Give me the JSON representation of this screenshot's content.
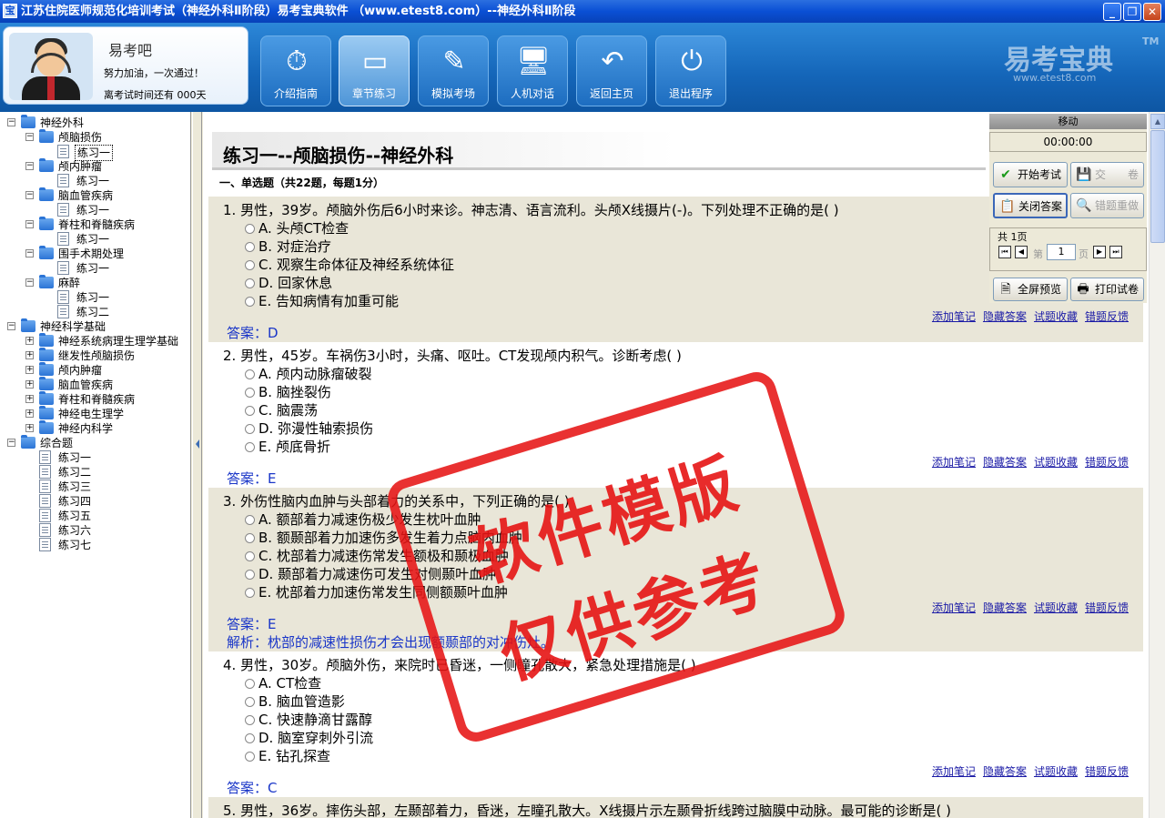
{
  "window": {
    "title": "江苏住院医师规范化培训考试（神经外科Ⅱ阶段）易考宝典软件  （www.etest8.com）--神经外科Ⅱ阶段",
    "app_icon": "宝"
  },
  "profile": {
    "name": "易考吧",
    "motto": "努力加油，一次通过！",
    "countdown": "离考试时间还有 000天"
  },
  "nav": [
    {
      "label": "介绍指南",
      "icon": "stopwatch-icon",
      "glyph": "⏱"
    },
    {
      "label": "章节练习",
      "icon": "windows-icon",
      "glyph": "▭"
    },
    {
      "label": "模拟考场",
      "icon": "exam-icon",
      "glyph": "✎"
    },
    {
      "label": "人机对话",
      "icon": "computer-user-icon",
      "glyph": "🖥"
    },
    {
      "label": "返回主页",
      "icon": "return-arrow-icon",
      "glyph": "↶"
    },
    {
      "label": "退出程序",
      "icon": "power-icon",
      "glyph": "⏻"
    }
  ],
  "logo": {
    "text": "易考宝典",
    "tm": "TM",
    "url": "www.etest8.com"
  },
  "tree": [
    {
      "label": "神经外科",
      "type": "folder",
      "level": 0,
      "toggle": "−"
    },
    {
      "label": "颅脑损伤",
      "type": "folder",
      "level": 1,
      "toggle": "−"
    },
    {
      "label": "练习一",
      "type": "page",
      "level": 2,
      "selected": true
    },
    {
      "label": "颅内肿瘤",
      "type": "folder",
      "level": 1,
      "toggle": "−"
    },
    {
      "label": "练习一",
      "type": "page",
      "level": 2
    },
    {
      "label": "脑血管疾病",
      "type": "folder",
      "level": 1,
      "toggle": "−"
    },
    {
      "label": "练习一",
      "type": "page",
      "level": 2
    },
    {
      "label": "脊柱和脊髓疾病",
      "type": "folder",
      "level": 1,
      "toggle": "−"
    },
    {
      "label": "练习一",
      "type": "page",
      "level": 2
    },
    {
      "label": "围手术期处理",
      "type": "folder",
      "level": 1,
      "toggle": "−"
    },
    {
      "label": "练习一",
      "type": "page",
      "level": 2
    },
    {
      "label": "麻醉",
      "type": "folder",
      "level": 1,
      "toggle": "−"
    },
    {
      "label": "练习一",
      "type": "page",
      "level": 2
    },
    {
      "label": "练习二",
      "type": "page",
      "level": 2
    },
    {
      "label": "神经科学基础",
      "type": "folder",
      "level": 0,
      "toggle": "−"
    },
    {
      "label": "神经系统病理生理学基础",
      "type": "folder",
      "level": 1,
      "toggle": "+"
    },
    {
      "label": "继发性颅脑损伤",
      "type": "folder",
      "level": 1,
      "toggle": "+"
    },
    {
      "label": "颅内肿瘤",
      "type": "folder",
      "level": 1,
      "toggle": "+"
    },
    {
      "label": "脑血管疾病",
      "type": "folder",
      "level": 1,
      "toggle": "+"
    },
    {
      "label": "脊柱和脊髓疾病",
      "type": "folder",
      "level": 1,
      "toggle": "+"
    },
    {
      "label": "神经电生理学",
      "type": "folder",
      "level": 1,
      "toggle": "+"
    },
    {
      "label": "神经内科学",
      "type": "folder",
      "level": 1,
      "toggle": "+"
    },
    {
      "label": "综合题",
      "type": "folder",
      "level": 0,
      "toggle": "−"
    },
    {
      "label": "练习一",
      "type": "page",
      "level": 1
    },
    {
      "label": "练习二",
      "type": "page",
      "level": 1
    },
    {
      "label": "练习三",
      "type": "page",
      "level": 1
    },
    {
      "label": "练习四",
      "type": "page",
      "level": 1
    },
    {
      "label": "练习五",
      "type": "page",
      "level": 1
    },
    {
      "label": "练习六",
      "type": "page",
      "level": 1
    },
    {
      "label": "练习七",
      "type": "page",
      "level": 1
    }
  ],
  "content": {
    "title": "练习一--颅脑损伤--神经外科",
    "section": "一、单选题（共22题，每题1分）",
    "links": [
      "添加笔记",
      "隐藏答案",
      "试题收藏",
      "错题反馈"
    ],
    "questions": [
      {
        "text": "1. 男性，39岁。颅脑外伤后6小时来诊。神志清、语言流利。头颅X线摄片(-)。下列处理不正确的是(   )",
        "options": [
          "A. 头颅CT检查",
          "B. 对症治疗",
          "C. 观察生命体征及神经系统体征",
          "D. 回家休息",
          "E. 告知病情有加重可能"
        ],
        "answer": "答案：D",
        "analysis": ""
      },
      {
        "text": "2. 男性，45岁。车祸伤3小时，头痛、呕吐。CT发现颅内积气。诊断考虑(   )",
        "options": [
          "A. 颅内动脉瘤破裂",
          "B. 脑挫裂伤",
          "C. 脑震荡",
          "D. 弥漫性轴索损伤",
          "E. 颅底骨折"
        ],
        "answer": "答案：E",
        "analysis": ""
      },
      {
        "text": "3. 外伤性脑内血肿与头部着力的关系中，下列正确的是(   )",
        "options": [
          "A. 额部着力减速伤极少发生枕叶血肿",
          "B. 额颞部着力加速伤多发生着力点脑内血肿",
          "C. 枕部着力减速伤常发生额极和颞极血肿",
          "D. 颞部着力减速伤可发生对侧颞叶血肿",
          "E. 枕部着力加速伤常发生同侧额颞叶血肿"
        ],
        "answer": "答案：E",
        "analysis": "解析：枕部的减速性损伤才会出现额颞部的对冲伤灶。"
      },
      {
        "text": "4. 男性，30岁。颅脑外伤，来院时已昏迷，一侧瞳孔散大，紧急处理措施是(   )",
        "options": [
          "A. CT检查",
          "B. 脑血管造影",
          "C. 快速静滴甘露醇",
          "D. 脑室穿刺外引流",
          "E. 钻孔探查"
        ],
        "answer": "答案：C",
        "analysis": ""
      },
      {
        "text": "5. 男性，36岁。摔伤头部，左颞部着力，昏迷，左瞳孔散大。X线摄片示左颞骨折线跨过脑膜中动脉。最可能的诊断是(   )",
        "options": [],
        "answer": "",
        "analysis": ""
      }
    ]
  },
  "side_panel": {
    "header": "移动",
    "timer": "00:00:00",
    "start_exam": "开始考试",
    "submit": "交　　卷",
    "close_answer": "关闭答案",
    "redo_wrong": "错题重做",
    "page_total": "共 1页",
    "page_prefix": "第",
    "page_value": "1",
    "page_suffix": "页",
    "fullscreen": "全屏预览",
    "print": "打印试卷"
  },
  "watermark": {
    "line1": "软件模版",
    "line2": "仅供参考"
  },
  "colors": {
    "accent": "#1465b8",
    "answer": "#1a36c8",
    "stamp": "#e61414",
    "shade": "#e9e6d8"
  }
}
